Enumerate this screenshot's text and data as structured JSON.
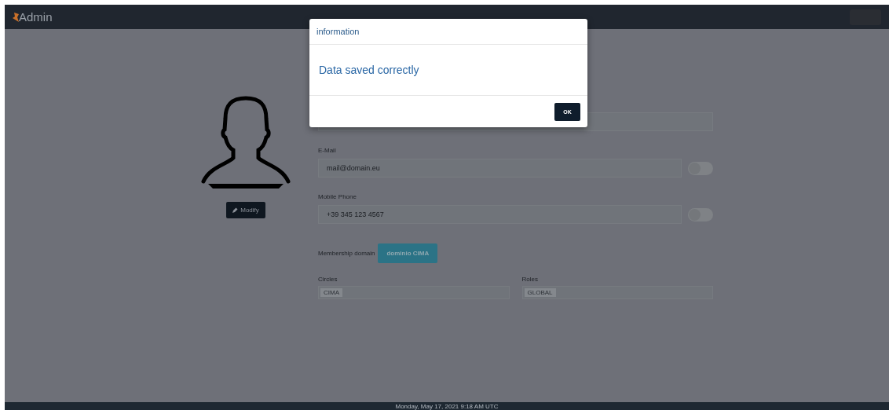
{
  "navbar": {
    "brand": "Admin"
  },
  "profile": {
    "modify_button": "Modify"
  },
  "form": {
    "fields": [
      {
        "label": "E-Mail",
        "placeholder": "mail@domain.eu",
        "on": false
      },
      {
        "label": "Mobile Phone",
        "placeholder": "+39 345 123 4567",
        "on": false
      }
    ],
    "membership": {
      "label": "Membership domain",
      "value": "dominio CIMA"
    },
    "tag_fields": [
      {
        "label": "Circles",
        "tags": [
          "CIMA"
        ]
      },
      {
        "label": "Roles",
        "tags": [
          "GLOBAL"
        ]
      }
    ]
  },
  "dialog": {
    "title": "information",
    "message": "Data saved correctly",
    "button": "OK"
  },
  "footer": {
    "text": "Monday, May 17, 2021 9:18 AM UTC"
  }
}
